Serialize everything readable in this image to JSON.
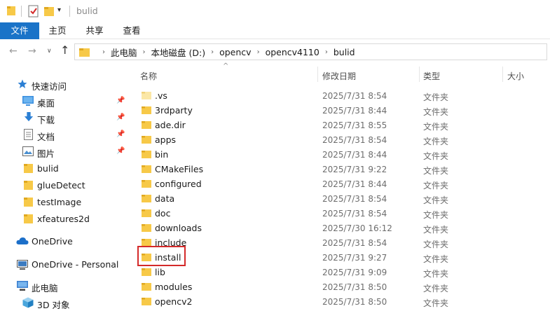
{
  "window": {
    "title": "bulid",
    "qa_dropdown": "▾"
  },
  "ribbon": {
    "tabs": [
      {
        "label": "文件"
      },
      {
        "label": "主页"
      },
      {
        "label": "共享"
      },
      {
        "label": "查看"
      }
    ]
  },
  "nav": {
    "back": "←",
    "forward": "→",
    "recent": "∨",
    "up": "↑",
    "crumb_sep": "›",
    "breadcrumbs": [
      "此电脑",
      "本地磁盘 (D:)",
      "opencv",
      "opencv4110",
      "bulid"
    ]
  },
  "sidebar": {
    "quick_access": {
      "label": "快速访问",
      "icon": "star-icon"
    },
    "items": [
      {
        "label": "桌面",
        "icon": "desktop-icon",
        "pinned": true
      },
      {
        "label": "下载",
        "icon": "download-icon",
        "pinned": true
      },
      {
        "label": "文档",
        "icon": "document-icon",
        "pinned": true
      },
      {
        "label": "图片",
        "icon": "pictures-icon",
        "pinned": true
      },
      {
        "label": "bulid",
        "icon": "folder-icon",
        "pinned": false
      },
      {
        "label": "glueDetect",
        "icon": "folder-icon",
        "pinned": false
      },
      {
        "label": "testImage",
        "icon": "folder-icon",
        "pinned": false
      },
      {
        "label": "xfeatures2d",
        "icon": "folder-icon",
        "pinned": false
      }
    ],
    "pin_glyph": "📌",
    "onedrive": {
      "label": "OneDrive",
      "icon": "cloud-icon"
    },
    "onedrive_personal": {
      "label": "OneDrive - Personal",
      "icon": "cloud-icon"
    },
    "this_pc": {
      "label": "此电脑",
      "icon": "computer-icon"
    },
    "objects_3d": {
      "label": "3D 对象",
      "icon": "cube-icon"
    }
  },
  "columns": {
    "name": "名称",
    "modified": "修改日期",
    "type": "类型",
    "size": "大小",
    "sort_indicator": "^"
  },
  "files": [
    {
      "name": ".vs",
      "modified": "2025/7/31 8:54",
      "type": "文件夹",
      "faded": true
    },
    {
      "name": "3rdparty",
      "modified": "2025/7/31 8:44",
      "type": "文件夹"
    },
    {
      "name": "ade.dir",
      "modified": "2025/7/31 8:55",
      "type": "文件夹"
    },
    {
      "name": "apps",
      "modified": "2025/7/31 8:54",
      "type": "文件夹"
    },
    {
      "name": "bin",
      "modified": "2025/7/31 8:44",
      "type": "文件夹"
    },
    {
      "name": "CMakeFiles",
      "modified": "2025/7/31 9:22",
      "type": "文件夹"
    },
    {
      "name": "configured",
      "modified": "2025/7/31 8:44",
      "type": "文件夹"
    },
    {
      "name": "data",
      "modified": "2025/7/31 8:54",
      "type": "文件夹"
    },
    {
      "name": "doc",
      "modified": "2025/7/31 8:54",
      "type": "文件夹"
    },
    {
      "name": "downloads",
      "modified": "2025/7/30 16:12",
      "type": "文件夹"
    },
    {
      "name": "include",
      "modified": "2025/7/31 8:54",
      "type": "文件夹"
    },
    {
      "name": "install",
      "modified": "2025/7/31 9:27",
      "type": "文件夹",
      "highlighted": true
    },
    {
      "name": "lib",
      "modified": "2025/7/31 9:09",
      "type": "文件夹"
    },
    {
      "name": "modules",
      "modified": "2025/7/31 8:50",
      "type": "文件夹"
    },
    {
      "name": "opencv2",
      "modified": "2025/7/31 8:50",
      "type": "文件夹"
    }
  ],
  "colors": {
    "accent": "#1a73c8",
    "folder": "#f7c948",
    "folder_dark": "#e0a820",
    "highlight": "#d42a2a"
  }
}
